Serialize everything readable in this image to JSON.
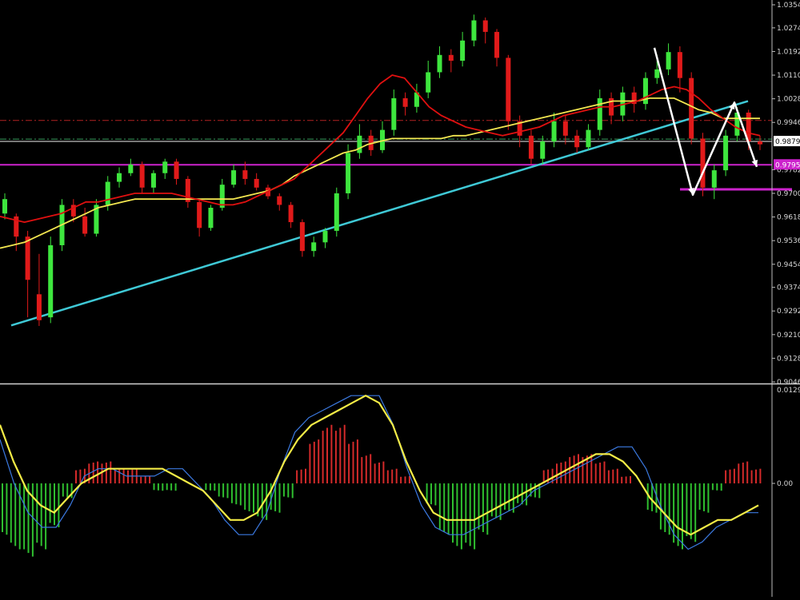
{
  "chart_data": [
    {
      "type": "candlestick",
      "title": "",
      "price_axis": {
        "ticks": [
          "1.03540",
          "1.02740",
          "1.01920",
          "1.01100",
          "1.00280",
          "0.99460",
          "0.97820",
          "0.97000",
          "0.96180",
          "0.95360",
          "0.94540",
          "0.93740",
          "0.92920",
          "0.92100",
          "0.91280",
          "0.90460"
        ],
        "tick_values": [
          1.0354,
          1.0274,
          1.0192,
          1.011,
          1.0028,
          0.9946,
          0.9782,
          0.97,
          0.9618,
          0.9536,
          0.9454,
          0.9374,
          0.9292,
          0.921,
          0.9128,
          0.9046
        ],
        "ylim": [
          0.9046,
          1.0354
        ],
        "current_price_label": "0.98797",
        "support_level_label": "0.97955"
      },
      "horizontal_levels": [
        {
          "value": 0.9799,
          "color": "#cc22cc",
          "style": "solid"
        },
        {
          "value": 0.9714,
          "color": "#cc22cc",
          "style": "solid",
          "segment": "short"
        },
        {
          "value": 0.9953,
          "color": "#b22222",
          "style": "dash-dot"
        },
        {
          "value": 0.9888,
          "color": "#3aa060",
          "style": "dash-dot"
        },
        {
          "value": 0.988,
          "color": "#777777",
          "style": "solid"
        }
      ],
      "trendline": {
        "from_price": 0.9242,
        "to_price": 1.002,
        "color": "#3fc9d6"
      },
      "ma_red": [
        0.962,
        0.961,
        0.96,
        0.961,
        0.962,
        0.963,
        0.965,
        0.967,
        0.967,
        0.968,
        0.969,
        0.97,
        0.97,
        0.97,
        0.97,
        0.969,
        0.968,
        0.967,
        0.966,
        0.966,
        0.967,
        0.969,
        0.971,
        0.973,
        0.975,
        0.979,
        0.983,
        0.987,
        0.991,
        0.997,
        1.003,
        1.008,
        1.011,
        1.01,
        1.005,
        1.0,
        0.997,
        0.995,
        0.993,
        0.992,
        0.991,
        0.99,
        0.991,
        0.992,
        0.993,
        0.995,
        0.997,
        0.998,
        0.999,
        1.0,
        1.0,
        1.001,
        1.002,
        1.004,
        1.006,
        1.007,
        1.006,
        1.003,
        0.999,
        0.996,
        0.993,
        0.991,
        0.99
      ],
      "ma_yellow": [
        0.951,
        0.952,
        0.953,
        0.955,
        0.957,
        0.959,
        0.961,
        0.963,
        0.965,
        0.966,
        0.967,
        0.968,
        0.968,
        0.968,
        0.968,
        0.968,
        0.968,
        0.968,
        0.968,
        0.968,
        0.969,
        0.97,
        0.971,
        0.973,
        0.976,
        0.978,
        0.98,
        0.982,
        0.984,
        0.985,
        0.987,
        0.988,
        0.989,
        0.989,
        0.989,
        0.989,
        0.989,
        0.99,
        0.99,
        0.991,
        0.992,
        0.993,
        0.994,
        0.995,
        0.996,
        0.997,
        0.998,
        0.999,
        1.0,
        1.001,
        1.002,
        1.002,
        1.002,
        1.003,
        1.003,
        1.003,
        1.001,
        0.999,
        0.998,
        0.996,
        0.996,
        0.996,
        0.996
      ],
      "candles": [
        [
          0.963,
          0.968,
          0.961,
          0.97
        ],
        [
          0.962,
          0.955,
          0.95,
          0.963
        ],
        [
          0.955,
          0.94,
          0.927,
          0.957
        ],
        [
          0.935,
          0.926,
          0.924,
          0.949
        ],
        [
          0.927,
          0.952,
          0.925,
          0.955
        ],
        [
          0.952,
          0.966,
          0.95,
          0.968
        ],
        [
          0.966,
          0.962,
          0.96,
          0.968
        ],
        [
          0.962,
          0.956,
          0.955,
          0.965
        ],
        [
          0.956,
          0.966,
          0.955,
          0.968
        ],
        [
          0.966,
          0.974,
          0.964,
          0.976
        ],
        [
          0.974,
          0.977,
          0.972,
          0.979
        ],
        [
          0.977,
          0.98,
          0.976,
          0.982
        ],
        [
          0.98,
          0.972,
          0.97,
          0.981
        ],
        [
          0.972,
          0.977,
          0.97,
          0.978
        ],
        [
          0.977,
          0.981,
          0.975,
          0.982
        ],
        [
          0.981,
          0.975,
          0.973,
          0.982
        ],
        [
          0.975,
          0.967,
          0.965,
          0.976
        ],
        [
          0.967,
          0.958,
          0.955,
          0.968
        ],
        [
          0.958,
          0.965,
          0.957,
          0.966
        ],
        [
          0.965,
          0.973,
          0.964,
          0.975
        ],
        [
          0.973,
          0.978,
          0.972,
          0.98
        ],
        [
          0.978,
          0.975,
          0.973,
          0.981
        ],
        [
          0.975,
          0.972,
          0.971,
          0.977
        ],
        [
          0.972,
          0.969,
          0.968,
          0.973
        ],
        [
          0.969,
          0.966,
          0.964,
          0.97
        ],
        [
          0.966,
          0.96,
          0.958,
          0.967
        ],
        [
          0.96,
          0.95,
          0.948,
          0.961
        ],
        [
          0.95,
          0.953,
          0.948,
          0.955
        ],
        [
          0.953,
          0.957,
          0.951,
          0.958
        ],
        [
          0.957,
          0.97,
          0.955,
          0.972
        ],
        [
          0.97,
          0.984,
          0.968,
          0.987
        ],
        [
          0.984,
          0.99,
          0.982,
          0.994
        ],
        [
          0.99,
          0.985,
          0.983,
          0.992
        ],
        [
          0.985,
          0.992,
          0.984,
          0.995
        ],
        [
          0.992,
          1.003,
          0.99,
          1.006
        ],
        [
          1.003,
          1.0,
          0.997,
          1.005
        ],
        [
          1.0,
          1.005,
          0.998,
          1.008
        ],
        [
          1.005,
          1.012,
          1.003,
          1.016
        ],
        [
          1.012,
          1.018,
          1.01,
          1.021
        ],
        [
          1.018,
          1.016,
          1.012,
          1.02
        ],
        [
          1.016,
          1.023,
          1.014,
          1.026
        ],
        [
          1.023,
          1.03,
          1.021,
          1.032
        ],
        [
          1.03,
          1.026,
          1.022,
          1.031
        ],
        [
          1.026,
          1.017,
          1.014,
          1.027
        ],
        [
          1.017,
          0.995,
          0.992,
          1.018
        ],
        [
          0.995,
          0.99,
          0.986,
          0.997
        ],
        [
          0.99,
          0.982,
          0.98,
          0.992
        ],
        [
          0.982,
          0.988,
          0.98,
          0.99
        ],
        [
          0.988,
          0.995,
          0.986,
          0.998
        ],
        [
          0.995,
          0.99,
          0.987,
          0.997
        ],
        [
          0.99,
          0.986,
          0.984,
          0.992
        ],
        [
          0.986,
          0.992,
          0.985,
          0.994
        ],
        [
          0.992,
          1.003,
          0.99,
          1.006
        ],
        [
          1.003,
          0.997,
          0.994,
          1.005
        ],
        [
          0.997,
          1.005,
          0.995,
          1.007
        ],
        [
          1.005,
          1.001,
          0.998,
          1.007
        ],
        [
          1.001,
          1.01,
          0.999,
          1.012
        ],
        [
          1.01,
          1.013,
          1.008,
          1.018
        ],
        [
          1.013,
          1.019,
          1.011,
          1.022
        ],
        [
          1.019,
          1.01,
          1.005,
          1.021
        ],
        [
          1.01,
          0.989,
          0.987,
          1.012
        ],
        [
          0.989,
          0.972,
          0.969,
          0.991
        ],
        [
          0.972,
          0.978,
          0.968,
          0.98
        ],
        [
          0.978,
          0.99,
          0.976,
          0.992
        ],
        [
          0.99,
          0.998,
          0.988,
          1.0
        ],
        [
          0.998,
          0.988,
          0.985,
          0.999
        ],
        [
          0.988,
          0.987,
          0.985,
          0.99
        ]
      ],
      "swing_arrows": [
        {
          "points": [
            1.0205,
            0.9695,
            1.0015,
            0.9792
          ],
          "color": "#ffffff"
        }
      ],
      "macd_panel": {
        "axis_ticks": [
          "0.01296",
          "0.00"
        ],
        "histogram": [
          -0.007,
          -0.009,
          -0.01,
          -0.009,
          -0.006,
          -0.002,
          0.002,
          0.003,
          0.003,
          0.002,
          0.002,
          0.001,
          -0.001,
          -0.001,
          0.0,
          0.0,
          -0.001,
          -0.002,
          -0.003,
          -0.004,
          -0.005,
          -0.004,
          -0.002,
          0.002,
          0.006,
          0.008,
          0.008,
          0.006,
          0.004,
          0.003,
          0.002,
          0.001,
          0.0,
          -0.003,
          -0.007,
          -0.009,
          -0.009,
          -0.007,
          -0.005,
          -0.004,
          -0.003,
          -0.002,
          0.002,
          0.003,
          0.004,
          0.004,
          0.003,
          0.002,
          0.001,
          0.0,
          -0.004,
          -0.007,
          -0.009,
          -0.008,
          -0.004,
          -0.001,
          0.002,
          0.003,
          0.002
        ],
        "signal": [
          0.008,
          0.003,
          -0.001,
          -0.003,
          -0.004,
          -0.002,
          0.0,
          0.001,
          0.002,
          0.002,
          0.002,
          0.002,
          0.002,
          0.001,
          0.0,
          -0.001,
          -0.003,
          -0.005,
          -0.005,
          -0.004,
          -0.001,
          0.003,
          0.006,
          0.008,
          0.009,
          0.01,
          0.011,
          0.012,
          0.011,
          0.008,
          0.003,
          -0.001,
          -0.004,
          -0.005,
          -0.005,
          -0.005,
          -0.004,
          -0.003,
          -0.002,
          -0.001,
          0.0,
          0.001,
          0.002,
          0.003,
          0.004,
          0.004,
          0.003,
          0.001,
          -0.002,
          -0.004,
          -0.006,
          -0.007,
          -0.006,
          -0.005,
          -0.005,
          -0.004,
          -0.003
        ],
        "macd": [
          0.006,
          0.0,
          -0.004,
          -0.006,
          -0.006,
          -0.003,
          0.001,
          0.002,
          0.002,
          0.001,
          0.001,
          0.001,
          0.002,
          0.002,
          0.0,
          -0.002,
          -0.005,
          -0.007,
          -0.007,
          -0.004,
          0.002,
          0.007,
          0.009,
          0.01,
          0.011,
          0.012,
          0.012,
          0.012,
          0.008,
          0.002,
          -0.003,
          -0.006,
          -0.007,
          -0.007,
          -0.006,
          -0.005,
          -0.004,
          -0.003,
          -0.001,
          0.0,
          0.001,
          0.002,
          0.003,
          0.004,
          0.005,
          0.005,
          0.002,
          -0.003,
          -0.007,
          -0.009,
          -0.008,
          -0.006,
          -0.005,
          -0.004,
          -0.004
        ],
        "ylim": [
          -0.0155,
          0.013
        ]
      },
      "colors": {
        "bull": "#3ee63e",
        "bear": "#e11a1a",
        "ma_red": "#e01010",
        "ma_yellow": "#f2e650",
        "trend": "#3fc9d6",
        "hist_pos": "#d42a2a",
        "hist_neg": "#2fbf2f",
        "signal": "#f4ec46",
        "macd_line": "#3b79e0",
        "axis_text": "#d6d6d6"
      }
    }
  ]
}
